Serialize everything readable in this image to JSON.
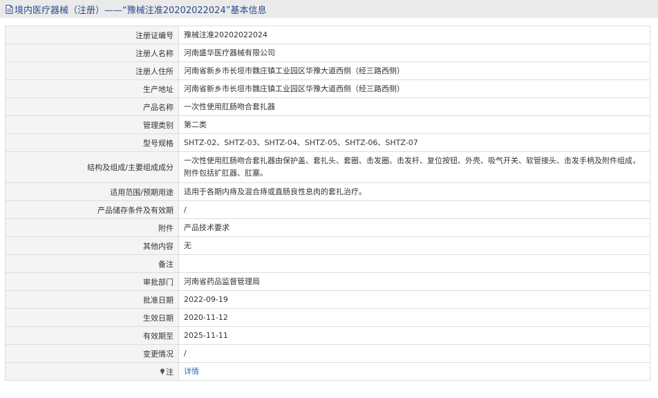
{
  "header": {
    "title": "境内医疗器械（注册）——“豫械注准20202022024”基本信息"
  },
  "rows": [
    {
      "label": "注册证编号",
      "value": "豫械注准20202022024"
    },
    {
      "label": "注册人名称",
      "value": "河南盛华医疗器械有限公司"
    },
    {
      "label": "注册人住所",
      "value": "河南省新乡市长垣市魏庄镇工业园区华豫大道西侧（经三路西侧）"
    },
    {
      "label": "生产地址",
      "value": "河南省新乡市长垣市魏庄镇工业园区华豫大道西侧（经三路西侧）"
    },
    {
      "label": "产品名称",
      "value": "一次性使用肛肠吻合套扎器"
    },
    {
      "label": "管理类别",
      "value": "第二类"
    },
    {
      "label": "型号规格",
      "value": "SHTZ-02、SHTZ-03、SHTZ-04、SHTZ-05、SHTZ-06、SHTZ-07"
    },
    {
      "label": "结构及组成/主要组成成分",
      "value": "一次性使用肛肠吻合套扎器由保护盖、套扎头、套圈、击发圈、击发杆、复位按钮、外壳、吸气开关、软管接头、击发手柄及附件组成，附件包括扩肛器、肛塞。"
    },
    {
      "label": "适用范围/预期用途",
      "value": "适用于各期内痔及混合痔或直肠良性息肉的套扎治疗。"
    },
    {
      "label": "产品储存条件及有效期",
      "value": "/"
    },
    {
      "label": "附件",
      "value": "产品技术要求"
    },
    {
      "label": "其他内容",
      "value": "无"
    },
    {
      "label": "备注",
      "value": ""
    },
    {
      "label": "审批部门",
      "value": "河南省药品监督管理局"
    },
    {
      "label": "批准日期",
      "value": "2022-09-19"
    },
    {
      "label": "生效日期",
      "value": "2020-11-12"
    },
    {
      "label": "有效期至",
      "value": "2025-11-11"
    },
    {
      "label": "变更情况",
      "value": "/"
    }
  ],
  "note_row": {
    "label": "注",
    "link_text": "详情",
    "icon": "pin-icon"
  },
  "colors": {
    "header_bg": "#eaeaea",
    "header_text": "#2a4a8c",
    "label_bg": "#f4f4f4",
    "link": "#2f6fb5"
  }
}
